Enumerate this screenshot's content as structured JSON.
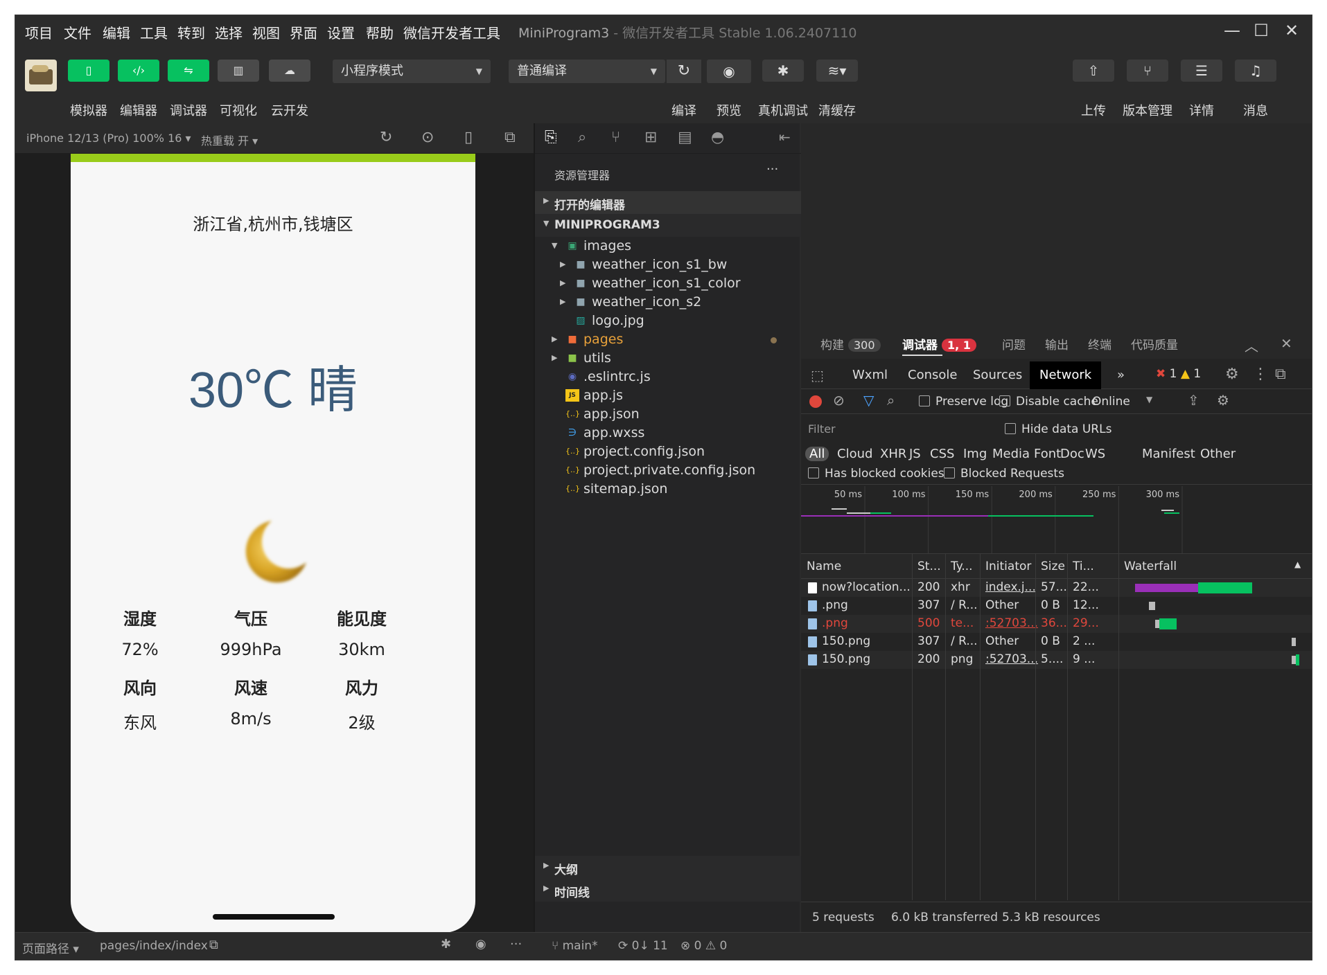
{
  "menu": [
    "项目",
    "文件",
    "编辑",
    "工具",
    "转到",
    "选择",
    "视图",
    "界面",
    "设置",
    "帮助",
    "微信开发者工具"
  ],
  "window": {
    "title": "MiniProgram3",
    "subtitle": " - 微信开发者工具 Stable 1.06.2407110"
  },
  "toolbar": {
    "left_buttons": [
      {
        "label": "模拟器",
        "icon": "phone-icon"
      },
      {
        "label": "编辑器",
        "icon": "code-icon"
      },
      {
        "label": "调试器",
        "icon": "debug-icon"
      },
      {
        "label": "可视化",
        "icon": "layout-icon"
      },
      {
        "label": "云开发",
        "icon": "cloud-icon"
      }
    ],
    "mode_select": "小程序模式",
    "compile_select": "普通编译",
    "mid_labels": [
      "编译",
      "预览",
      "真机调试",
      "清缓存"
    ],
    "right_labels": [
      "上传",
      "版本管理",
      "详情",
      "消息"
    ]
  },
  "simulator": {
    "device": "iPhone 12/13 (Pro) 100% 16 ▾",
    "hot_reload": "热重载 开 ▾",
    "page": {
      "location": "浙江省,杭州市,钱塘区",
      "weather": "30℃ 晴",
      "stats": [
        {
          "label": "湿度",
          "value": "72%"
        },
        {
          "label": "气压",
          "value": "999hPa"
        },
        {
          "label": "能见度",
          "value": "30km"
        },
        {
          "label": "风向",
          "value": "东风"
        },
        {
          "label": "风速",
          "value": "8m/s"
        },
        {
          "label": "风力",
          "value": "2级"
        }
      ]
    }
  },
  "status": {
    "path_label": "页面路径 ▾",
    "path": "pages/index/index"
  },
  "explorer": {
    "title": "资源管理器",
    "more": "···",
    "open_editors": "打开的编辑器",
    "project": "MINIPROGRAM3",
    "files": [
      {
        "name": "images",
        "icon": "folder-images-icon",
        "icon_char": "▣",
        "color": "#3aa675"
      },
      {
        "name": "weather_icon_s1_bw",
        "icon": "folder-icon",
        "icon_char": "■",
        "color": "#90a4ae"
      },
      {
        "name": "weather_icon_s1_color",
        "icon": "folder-icon",
        "icon_char": "■",
        "color": "#90a4ae"
      },
      {
        "name": "weather_icon_s2",
        "icon": "folder-icon",
        "icon_char": "■",
        "color": "#90a4ae"
      },
      {
        "name": "logo.jpg",
        "icon": "image-file-icon",
        "icon_char": "▨",
        "color": "#26a69a"
      },
      {
        "name": "pages",
        "icon": "folder-pages-icon",
        "icon_char": "■",
        "color": "#ef6c3a"
      },
      {
        "name": "utils",
        "icon": "folder-utils-icon",
        "icon_char": "■",
        "color": "#8bc34a"
      },
      {
        "name": ".eslintrc.js",
        "icon": "eslint-icon",
        "icon_char": "◉",
        "color": "#5c6bc0"
      },
      {
        "name": "app.js",
        "icon": "js-file-icon",
        "icon_char": "JS",
        "color": "#f5c518"
      },
      {
        "name": "app.json",
        "icon": "json-file-icon",
        "icon_char": "{..}",
        "color": "#f5c518"
      },
      {
        "name": "app.wxss",
        "icon": "css-file-icon",
        "icon_char": "∋",
        "color": "#42a5f5"
      },
      {
        "name": "project.config.json",
        "icon": "json-file-icon",
        "icon_char": "{..}",
        "color": "#f5c518"
      },
      {
        "name": "project.private.config.json",
        "icon": "json-file-icon",
        "icon_char": "{..}",
        "color": "#f5c518"
      },
      {
        "name": "sitemap.json",
        "icon": "json-file-icon",
        "icon_char": "{..}",
        "color": "#f5c518"
      }
    ],
    "outline": "大纲",
    "timeline": "时间线",
    "git": {
      "branch": "main*",
      "sync": "0↓ 11",
      "problems": "⊗ 0 ⚠ 0"
    }
  },
  "devtools": {
    "tabs": [
      {
        "label": "构建",
        "badge": "300"
      },
      {
        "label": "调试器",
        "badge": "1, 1"
      },
      {
        "label": "问题"
      },
      {
        "label": "输出"
      },
      {
        "label": "终端"
      },
      {
        "label": "代码质量"
      }
    ],
    "subtabs": [
      "Wxml",
      "Console",
      "Sources",
      "Network",
      "»"
    ],
    "errors": "1",
    "warnings": "1",
    "preserve_log": "Preserve log",
    "disable_cache": "Disable cache",
    "throttle": "Online",
    "filter_placeholder": "Filter",
    "hide_data_urls": "Hide data URLs",
    "types": [
      "All",
      "Cloud",
      "XHR",
      "JS",
      "CSS",
      "Img",
      "Media",
      "Font",
      "Doc",
      "WS",
      "Manifest",
      "Other"
    ],
    "has_blocked": "Has blocked cookies",
    "blocked_requests": "Blocked Requests",
    "ruler_ticks": [
      "50 ms",
      "100 ms",
      "150 ms",
      "200 ms",
      "250 ms",
      "300 ms"
    ],
    "columns": [
      "Name",
      "St...",
      "Ty...",
      "Initiator",
      "Size",
      "Ti...",
      "Waterfall"
    ],
    "requests": [
      {
        "name": "now?location...",
        "status": "200",
        "type": "xhr",
        "initiator": "index.j...",
        "size": "57...",
        "time": "22...",
        "error": false,
        "waterfall_start": 0.04,
        "waterfall_wait": 0.62,
        "waterfall_recv": 0.35
      },
      {
        "name": ".png",
        "status": "307",
        "type": "/ R...",
        "initiator": "Other",
        "size": "0 B",
        "time": "12...",
        "error": false,
        "waterfall_start": 0.12,
        "waterfall_wait": 0.04,
        "waterfall_recv": 0
      },
      {
        "name": ".png",
        "status": "500",
        "type": "te...",
        "initiator": ":52703...",
        "size": "36...",
        "time": "29...",
        "error": true,
        "waterfall_start": 0.16,
        "waterfall_wait": 0.04,
        "waterfall_recv": 0.1
      },
      {
        "name": "150.png",
        "status": "307",
        "type": "/ R...",
        "initiator": "Other",
        "size": "0 B",
        "time": "2 ...",
        "error": false,
        "waterfall_start": 0.96,
        "waterfall_wait": 0.01,
        "waterfall_recv": 0
      },
      {
        "name": "150.png",
        "status": "200",
        "type": "png",
        "initiator": ":52703...",
        "size": "5....",
        "time": "9 ...",
        "error": false,
        "waterfall_start": 0.96,
        "waterfall_wait": 0.02,
        "waterfall_recv": 0.02
      }
    ],
    "summary": [
      "5 requests",
      "6.0 kB transferred",
      "5.3 kB resources"
    ]
  },
  "colors": {
    "accent": "#07c160",
    "error": "#e0473c",
    "phone_top": "#99cc1a",
    "temp": "#3b5b7a"
  }
}
